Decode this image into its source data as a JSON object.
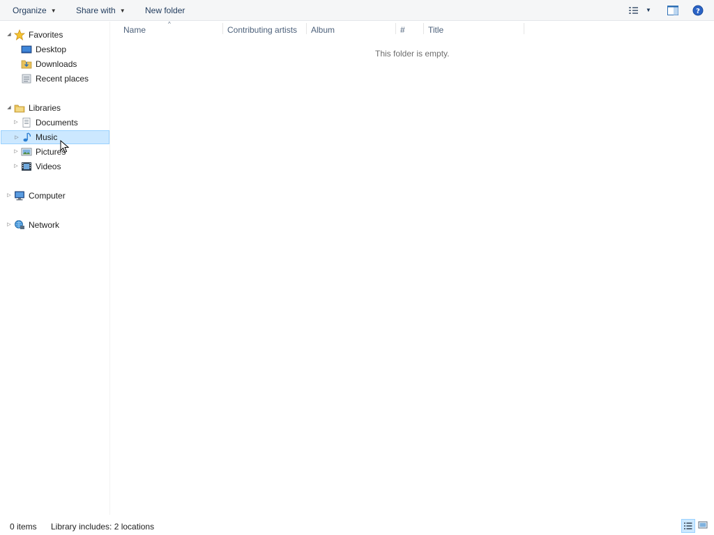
{
  "toolbar": {
    "organize": "Organize",
    "share_with": "Share with",
    "new_folder": "New folder",
    "icons": [
      "view-options-icon",
      "preview-pane-icon",
      "help-icon"
    ]
  },
  "nav": {
    "favorites": {
      "label": "Favorites",
      "items": [
        "Desktop",
        "Downloads",
        "Recent places"
      ]
    },
    "libraries": {
      "label": "Libraries",
      "items": [
        "Documents",
        "Music",
        "Pictures",
        "Videos"
      ],
      "selected": "Music"
    },
    "computer": "Computer",
    "network": "Network"
  },
  "columns": [
    "Name",
    "Contributing artists",
    "Album",
    "#",
    "Title"
  ],
  "content": {
    "empty_message": "This folder is empty."
  },
  "status": {
    "item_count": "0 items",
    "library_info": "Library includes: 2 locations"
  },
  "colors": {
    "selection_bg": "#cce8ff",
    "selection_border": "#99d1ff",
    "link_text": "#1e395b"
  }
}
